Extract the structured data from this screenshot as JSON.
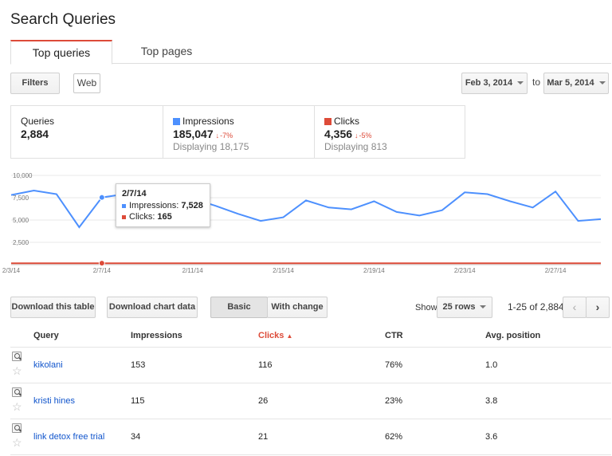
{
  "page_title": "Search Queries",
  "tabs": [
    {
      "label": "Top queries",
      "active": true
    },
    {
      "label": "Top pages",
      "active": false
    }
  ],
  "toolbar": {
    "filters_label": "Filters",
    "web_label": "Web",
    "start_date": "Feb 3, 2014",
    "to_label": "to",
    "end_date": "Mar 5, 2014"
  },
  "metrics": {
    "queries": {
      "label": "Queries",
      "value": "2,884"
    },
    "impressions": {
      "label": "Impressions",
      "value": "185,047",
      "delta": "-7%",
      "sub": "Displaying 18,175",
      "color": "#4d90fe"
    },
    "clicks": {
      "label": "Clicks",
      "value": "4,356",
      "delta": "-5%",
      "sub": "Displaying 813",
      "color": "#dd4b39"
    }
  },
  "chart_data": {
    "type": "line",
    "x_tick_labels": [
      "2/3/14",
      "2/7/14",
      "2/11/14",
      "2/15/14",
      "2/19/14",
      "2/23/14",
      "2/27/14"
    ],
    "y_tick_labels": [
      "10,000",
      "7,500",
      "5,000",
      "2,500"
    ],
    "ylim": [
      0,
      10000
    ],
    "grid": true,
    "series": [
      {
        "name": "Impressions",
        "color": "#4d90fe",
        "values": [
          7800,
          8300,
          7900,
          4200,
          7528,
          7900,
          8200,
          7700,
          7400,
          6600,
          5700,
          4900,
          5300,
          7200,
          6400,
          6200,
          7100,
          5900,
          5500,
          6100,
          8100,
          7900,
          7100,
          6400,
          8200,
          4900,
          5100
        ]
      },
      {
        "name": "Clicks",
        "color": "#dd4b39",
        "values": [
          160,
          158,
          162,
          150,
          165,
          150,
          155,
          160,
          158,
          157,
          155,
          150,
          152,
          160,
          158,
          155,
          160,
          157,
          150,
          155,
          162,
          160,
          158,
          155,
          160,
          150,
          152
        ]
      }
    ],
    "tooltip": {
      "date": "2/7/14",
      "impressions_label": "Impressions:",
      "impressions_value": "7,528",
      "clicks_label": "Clicks:",
      "clicks_value": "165"
    }
  },
  "actions": {
    "download_table": "Download this table",
    "download_chart": "Download chart data",
    "basic": "Basic",
    "with_change": "With change",
    "show_label": "Show",
    "rows_select": "25 rows",
    "range": "1-25 of 2,884",
    "prev": "‹",
    "next": "›"
  },
  "table": {
    "columns": [
      "Query",
      "Impressions",
      "Clicks",
      "CTR",
      "Avg. position"
    ],
    "sort_indicator": "▲",
    "rows": [
      {
        "query": "kikolani",
        "impressions": "153",
        "clicks": "116",
        "ctr": "76%",
        "position": "1.0"
      },
      {
        "query": "kristi hines",
        "impressions": "115",
        "clicks": "26",
        "ctr": "23%",
        "position": "3.8"
      },
      {
        "query": "link detox free trial",
        "impressions": "34",
        "clicks": "21",
        "ctr": "62%",
        "position": "3.6"
      }
    ]
  }
}
